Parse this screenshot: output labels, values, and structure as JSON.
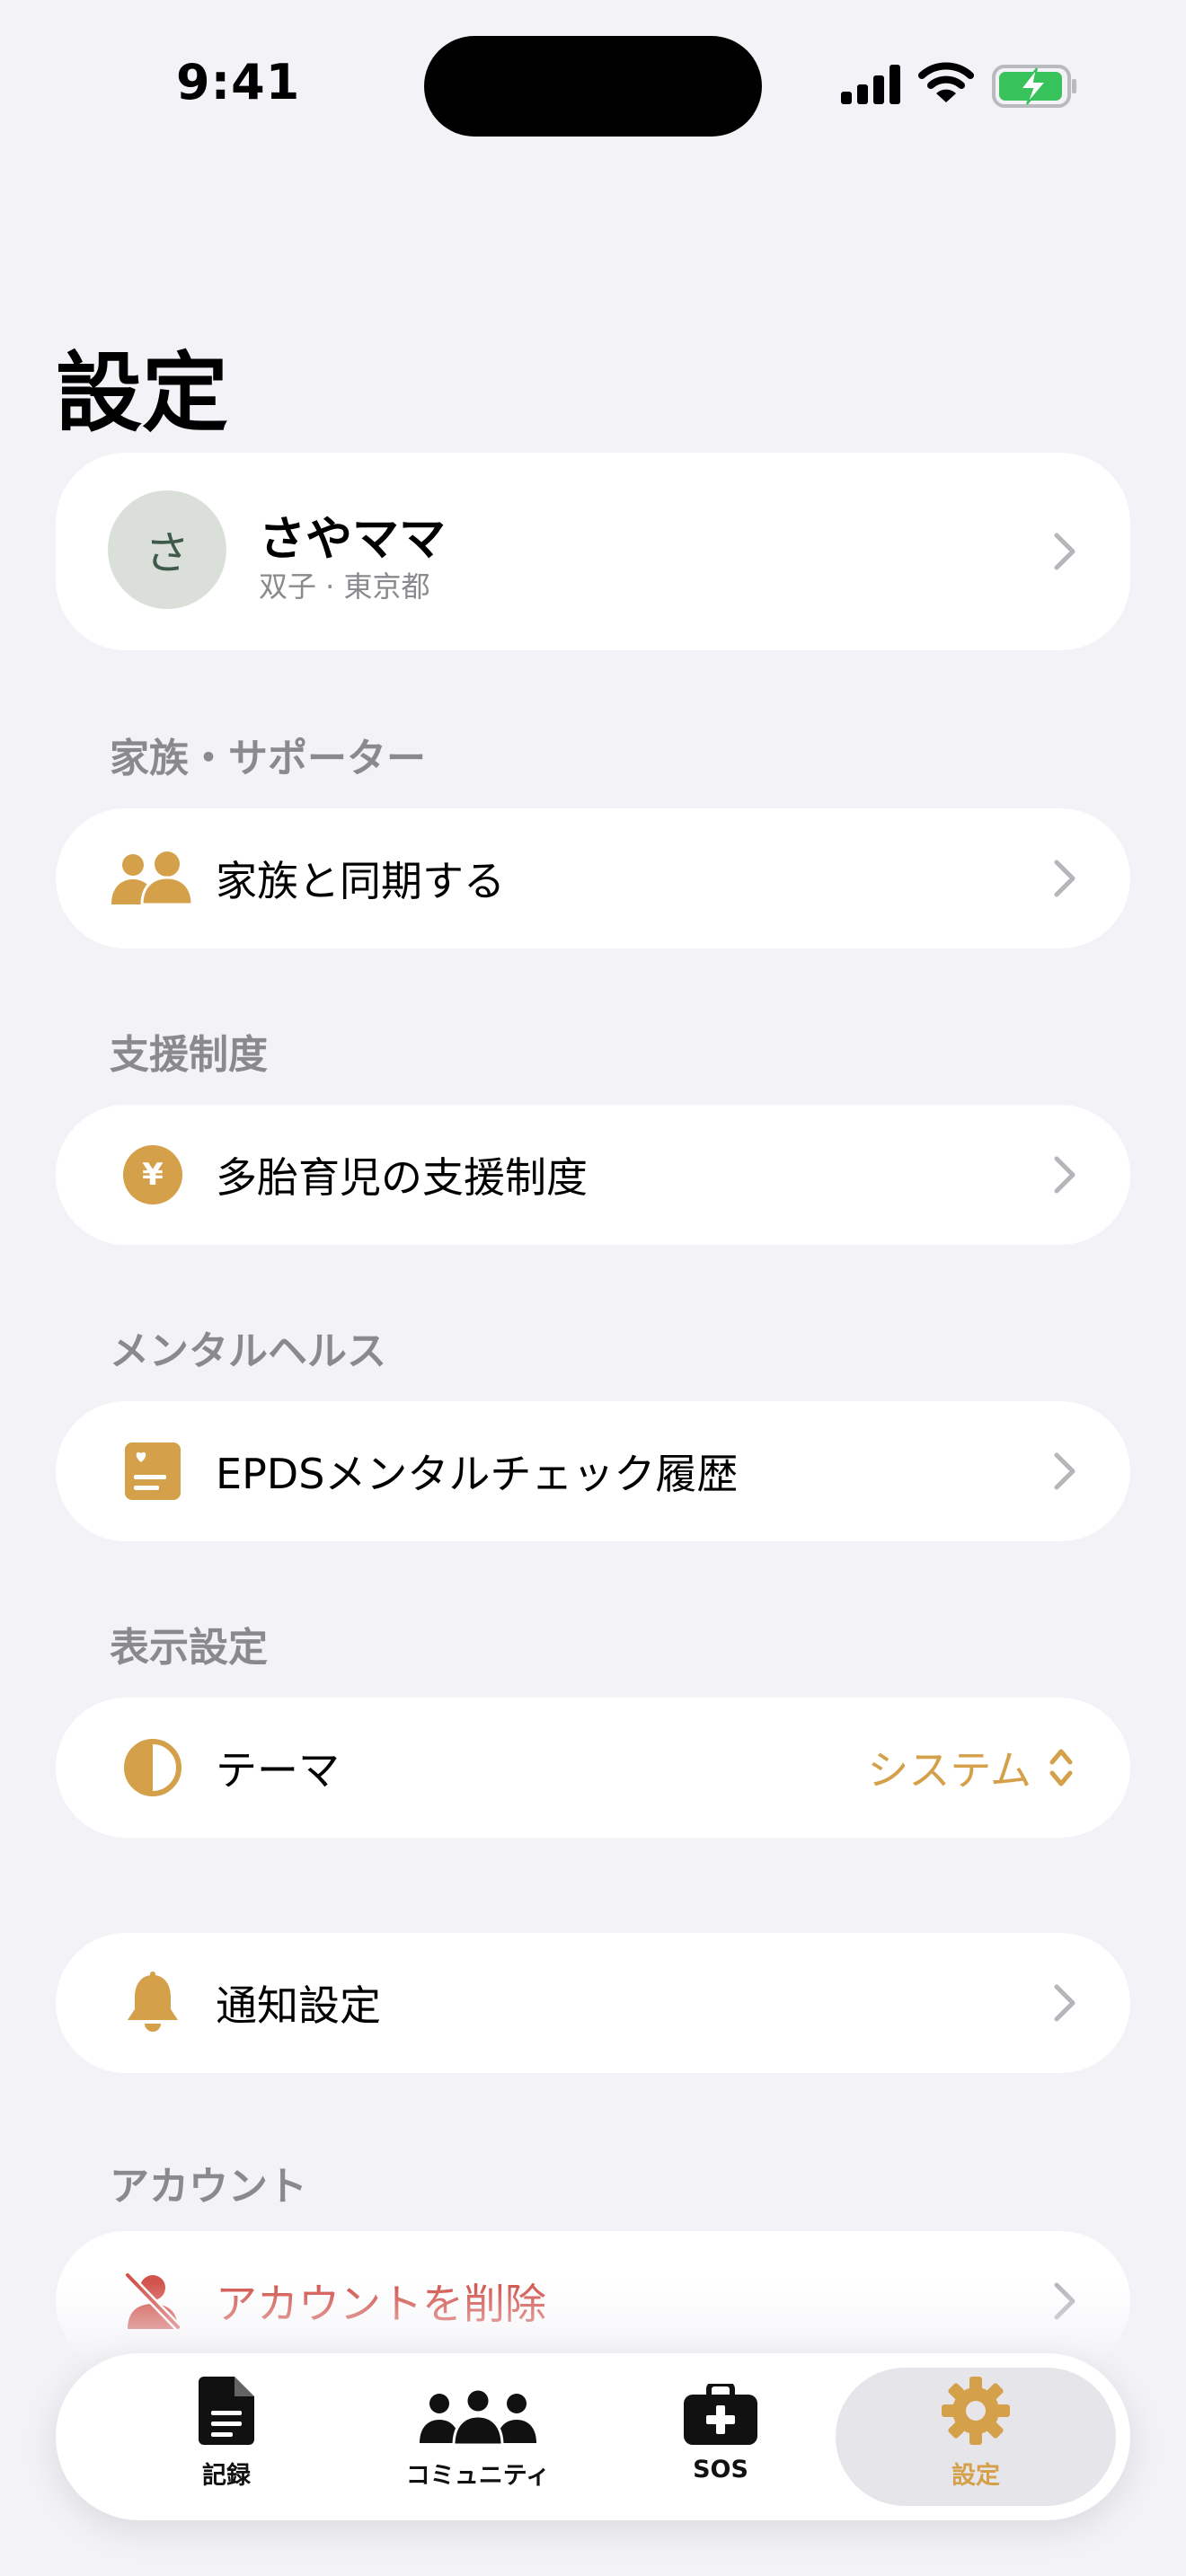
{
  "status_bar": {
    "time": "9:41"
  },
  "page_title": "設定",
  "profile": {
    "avatar_initial": "さ",
    "name": "さやママ",
    "subtitle": "双子 · 東京都"
  },
  "sections": {
    "family": {
      "header": "家族・サポーター",
      "row_label": "家族と同期する",
      "icon": "people-icon"
    },
    "support": {
      "header": "支援制度",
      "row_label": "多胎育児の支援制度",
      "icon": "yen-icon",
      "icon_glyph": "¥"
    },
    "mental": {
      "header": "メンタルヘルス",
      "row_label": "EPDSメンタルチェック履歴",
      "icon": "heart-clipboard-icon"
    },
    "display": {
      "header": "表示設定",
      "row_label": "テーマ",
      "value": "システム",
      "icon": "half-circle-icon"
    },
    "notifications": {
      "row_label": "通知設定",
      "icon": "bell-icon"
    },
    "account": {
      "header": "アカウント",
      "row_label": "アカウントを削除",
      "icon": "person-slash-icon"
    }
  },
  "tab_bar": [
    {
      "label": "記録",
      "icon": "document-icon",
      "active": false
    },
    {
      "label": "コミュニティ",
      "icon": "community-icon",
      "active": false
    },
    {
      "label": "SOS",
      "icon": "first-aid-kit-icon",
      "active": false
    },
    {
      "label": "設定",
      "icon": "gear-icon",
      "active": true
    }
  ],
  "colors": {
    "accent": "#D4A04A",
    "danger": "#D2534B",
    "background": "#F2F2F7",
    "secondary_text": "#8A8A8E"
  }
}
